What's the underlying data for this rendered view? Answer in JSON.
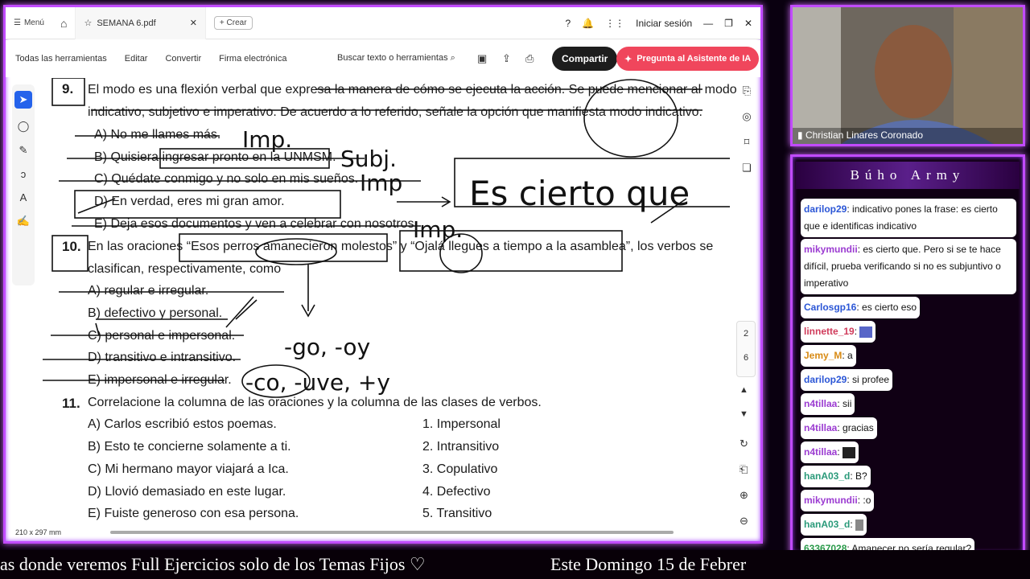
{
  "topbar": {
    "menu_label": "Menú",
    "tab_title": "SEMANA 6.pdf",
    "new_tab_label": "Crear",
    "signin_label": "Iniciar sesión"
  },
  "toolbar": {
    "items": [
      "Todas las herramientas",
      "Editar",
      "Convertir",
      "Firma electrónica"
    ],
    "search_label": "Buscar texto o herramientas",
    "share_label": "Compartir",
    "ai_label": "Pregunta al Asistente de IA"
  },
  "page_nav": {
    "current": "2",
    "total": "6"
  },
  "statusbar": {
    "page_size": "210 x 297 mm"
  },
  "document": {
    "q9": {
      "number": "9.",
      "line1": "El modo es una flexión verbal que expresa la manera de cómo se ejecuta la acción. Se puede mencionar al modo",
      "line2": "indicativo, subjetivo e imperativo. De acuerdo a lo referido, señale la opción que manifiesta modo indicativo.",
      "options": [
        "A)   No me llames más.",
        "B)   Quisiera ingresar pronto en la UNMSM.",
        "C)   Quédate conmigo y no solo en mis sueños.",
        "D)   En verdad, eres mi gran amor.",
        "E)   Deja esos documentos y ven a celebrar con nosotros."
      ]
    },
    "q10": {
      "number": "10.",
      "line1": "En las oraciones “Esos perros amanecieron molestos” y “Ojalá llegues a tiempo a la asamblea”, los verbos se",
      "line2": "clasifican, respectivamente, como",
      "options": [
        "A) regular e irregular.",
        "B) defectivo y personal.",
        "C) personal e impersonal.",
        "D) transitivo e intransitivo.",
        "E) impersonal e irregular."
      ]
    },
    "q11": {
      "number": "11.",
      "line1": "Correlacione la columna de las oraciones y la columna de las clases de verbos.",
      "left": [
        "A) Carlos escribió estos poemas.",
        "B) Esto te concierne solamente a ti.",
        "C) Mi hermano mayor viajará a Ica.",
        "D) Llovió demasiado en este lugar.",
        "E) Fuiste generoso con esa persona."
      ],
      "right": [
        "1. Impersonal",
        "2. Intransitivo",
        "3. Copulativo",
        "4. Defectivo",
        "5. Transitivo"
      ]
    }
  },
  "handwriting": {
    "a": "Imp.",
    "b": "Subj.",
    "c": "Imp",
    "e": "Imp.",
    "box": "Es cierto que",
    "suffixes1": "-go, -oy",
    "suffixes2": "-co, -uve, +y"
  },
  "webcam": {
    "name": "Christian Linares Coronado"
  },
  "chat": {
    "title": "Búho Army",
    "messages": [
      {
        "user": "darilop29",
        "color": "#2b56d6",
        "text": ": indicativo pones la frase: es cierto que e identificas indicativo"
      },
      {
        "user": "mikymundii",
        "color": "#9b3bd1",
        "text": ": es cierto que. Pero si se te hace difícil, prueba verificando si no es subjuntivo o imperativo"
      },
      {
        "user": "Carlosgp16",
        "color": "#2b56d6",
        "text": ": es cierto eso"
      },
      {
        "user": "linnette_19",
        "color": "#d03b5b",
        "text": ": "
      },
      {
        "user": "Jemy_M",
        "color": "#d88a14",
        "text": ": a"
      },
      {
        "user": "darilop29",
        "color": "#2b56d6",
        "text": ": si profee"
      },
      {
        "user": "n4tillaa",
        "color": "#9b3bd1",
        "text": ": sii"
      },
      {
        "user": "n4tillaa",
        "color": "#9b3bd1",
        "text": ": gracias"
      },
      {
        "user": "n4tillaa",
        "color": "#9b3bd1",
        "text": ": "
      },
      {
        "user": "hanA03_d",
        "color": "#2a9a7a",
        "text": ": B?"
      },
      {
        "user": "mikymundii",
        "color": "#9b3bd1",
        "text": ": :o"
      },
      {
        "user": "hanA03_d",
        "color": "#2a9a7a",
        "text": ": "
      },
      {
        "user": "63367028",
        "color": "#2a9a4a",
        "text": ": Amanecer no sería regular?"
      }
    ]
  },
  "ticker": {
    "part1": "as donde veremos Full Ejercicios solo de los Temas Fijos ♡",
    "part2": "Este Domingo 15 de Febrer"
  },
  "colors": {
    "frame": "#c14bff",
    "share_bg": "#1d1d1d",
    "ai_bg": "#f0465c",
    "select": "#2563eb"
  }
}
